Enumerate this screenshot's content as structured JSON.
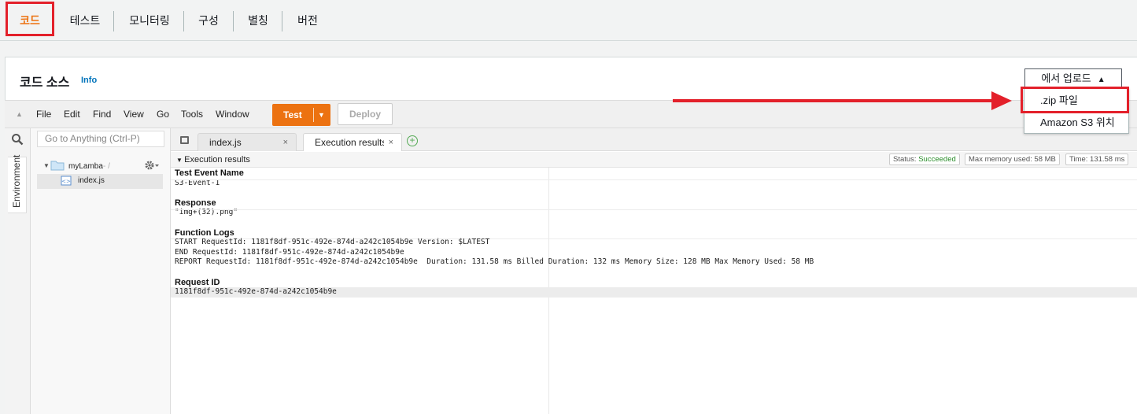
{
  "tabs": [
    {
      "label": "코드"
    },
    {
      "label": "테스트"
    },
    {
      "label": "모니터링"
    },
    {
      "label": "구성"
    },
    {
      "label": "별칭"
    },
    {
      "label": "버전"
    }
  ],
  "panel": {
    "title": "코드 소스",
    "info": "Info",
    "upload_button": "에서 업로드",
    "dropdown": [
      "zip 파일",
      "Amazon S3 위치"
    ]
  },
  "ide": {
    "menu": [
      "File",
      "Edit",
      "Find",
      "View",
      "Go",
      "Tools",
      "Window"
    ],
    "test_button": "Test",
    "deploy_button": "Deploy",
    "goto_placeholder": "Go to Anything (Ctrl-P)",
    "environment_tab": "Environment",
    "tree": {
      "folder": "myLamba",
      "folder_suffix": "- /",
      "file": "index.js"
    },
    "editor_tabs": [
      {
        "label": "index.js"
      },
      {
        "label": "Execution results"
      }
    ]
  },
  "results": {
    "header": "Execution results",
    "status_label": "Status:",
    "status_value": "Succeeded",
    "memory": "Max memory used: 58 MB",
    "time": "Time: 131.58 ms",
    "sections": {
      "test_event_title": "Test Event Name",
      "test_event_value": "S3-Event-1",
      "response_title": "Response",
      "response_value": "\"img+(32).png\"",
      "logs_title": "Function Logs",
      "log_lines": [
        "START RequestId: 1181f8df-951c-492e-874d-a242c1054b9e Version: $LATEST",
        "END RequestId: 1181f8df-951c-492e-874d-a242c1054b9e",
        "REPORT RequestId: 1181f8df-951c-492e-874d-a242c1054b9e  Duration: 131.58 ms Billed Duration: 132 ms Memory Size: 128 MB Max Memory Used: 58 MB"
      ],
      "request_id_title": "Request ID",
      "request_id_value": "1181f8df-951c-492e-874d-a242c1054b9e"
    }
  },
  "colors": {
    "accent": "#ec7211",
    "highlight": "#e3202a",
    "link": "#0073bb",
    "success": "#2a8d2a"
  }
}
